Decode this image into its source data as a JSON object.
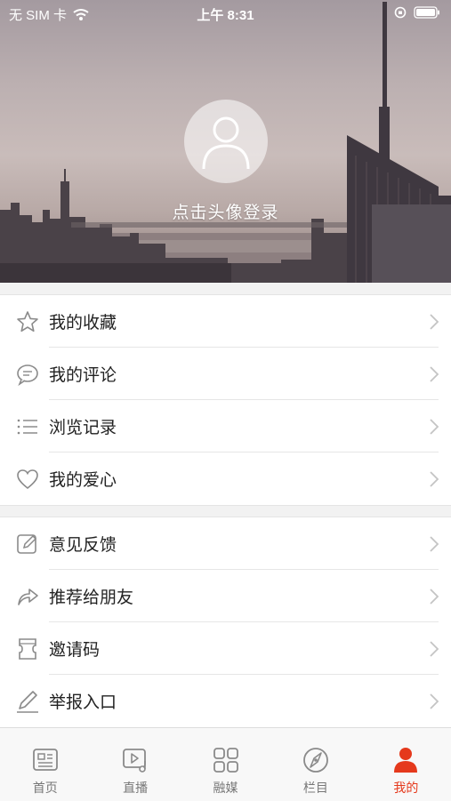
{
  "status_bar": {
    "carrier": "无 SIM 卡",
    "time": "上午 8:31"
  },
  "profile": {
    "login_prompt": "点击头像登录"
  },
  "menu_group_1": [
    {
      "label": "我的收藏",
      "icon": "star-icon"
    },
    {
      "label": "我的评论",
      "icon": "comment-icon"
    },
    {
      "label": "浏览记录",
      "icon": "history-list-icon"
    },
    {
      "label": "我的爱心",
      "icon": "heart-icon"
    }
  ],
  "menu_group_2": [
    {
      "label": "意见反馈",
      "icon": "edit-feedback-icon"
    },
    {
      "label": "推荐给朋友",
      "icon": "share-arrow-icon"
    },
    {
      "label": "邀请码",
      "icon": "invite-code-icon"
    },
    {
      "label": "举报入口",
      "icon": "pen-report-icon"
    }
  ],
  "tab_bar": [
    {
      "label": "首页",
      "icon": "news-icon",
      "active": false
    },
    {
      "label": "直播",
      "icon": "live-video-icon",
      "active": false
    },
    {
      "label": "融媒",
      "icon": "grid-icon",
      "active": false
    },
    {
      "label": "栏目",
      "icon": "compass-icon",
      "active": false
    },
    {
      "label": "我的",
      "icon": "person-icon",
      "active": true
    }
  ],
  "colors": {
    "accent": "#e5391c",
    "icon_gray": "#8a8a8a",
    "chevron": "#c4c4c4"
  }
}
